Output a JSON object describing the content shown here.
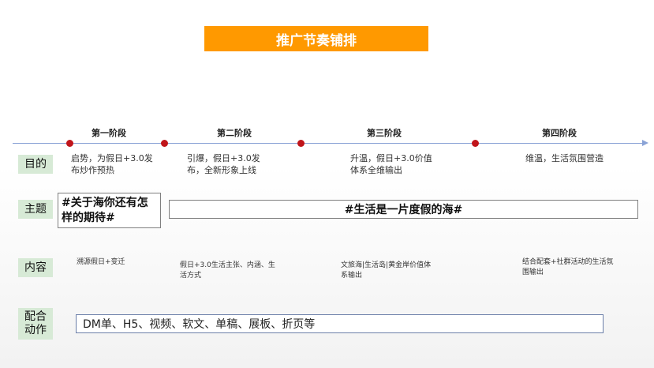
{
  "title": "推广节奏铺排",
  "stages": [
    "第一阶段",
    "第二阶段",
    "第三阶段",
    "第四阶段"
  ],
  "rows": {
    "goal_label": "目的",
    "theme_label": "主题",
    "content_label": "内容",
    "coop_label": "配合动作"
  },
  "goals": [
    "启势，为假日+3.0发布炒作预热",
    "引爆，假日+3.0发布，全新形象上线",
    "升温，假日+3.0价值体系全维输出",
    "维温，生活氛围营造"
  ],
  "themes": {
    "left": "#关于海你还有怎样的期待#",
    "right": "#生活是一片度假的海#"
  },
  "contents": [
    "溯源假日+变迁",
    "假日+3.0生活主张、内涵、生活方式",
    "文旅海|生活岛|黄金岸价值体系输出",
    "结合配套+社群活动的生活氛围输出"
  ],
  "coop": "DM单、H5、视频、软文、单稿、展板、折页等",
  "colors": {
    "title_bg": "#ff9900",
    "label_bg": "#d7ead6",
    "dot": "#c0151b",
    "line": "#8aa3d6"
  }
}
